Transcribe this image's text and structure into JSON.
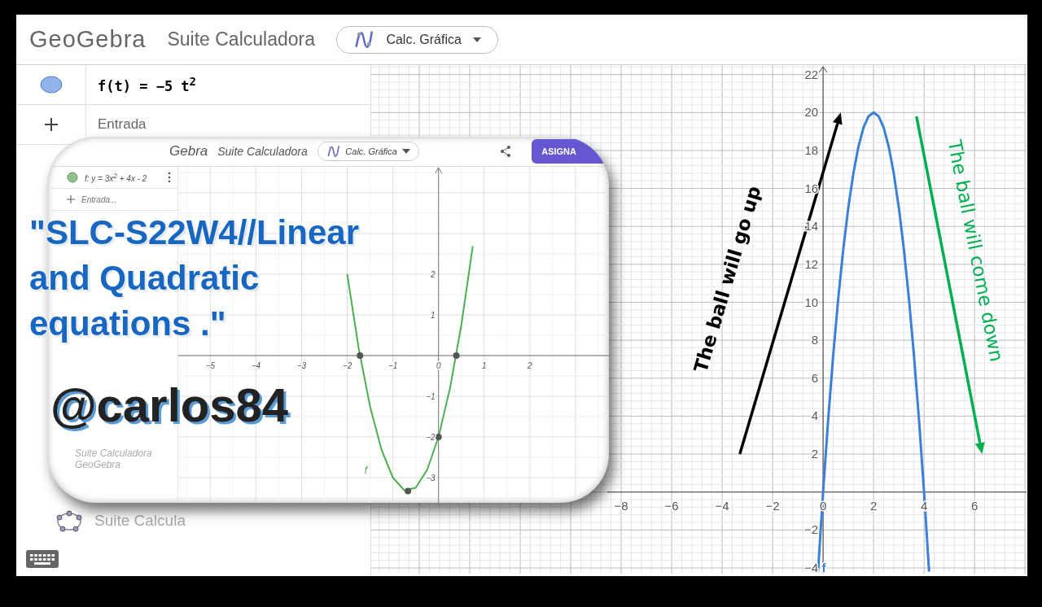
{
  "header": {
    "logo": "GeoGebra",
    "title": "Suite Calculadora",
    "app_menu": "Calc. Gráfica"
  },
  "algebra": {
    "expression": "f(t) = −5 t$^{2}$",
    "input_placeholder": "Entrada",
    "brand": "Suite Calcula"
  },
  "graph": {
    "chart_data": {
      "type": "line",
      "x": [
        -0.2,
        0,
        0.2,
        0.4,
        0.6,
        0.8,
        1,
        1.2,
        1.4,
        1.6,
        1.8,
        2,
        2.2,
        2.4,
        2.6,
        2.8,
        3,
        3.2,
        3.4,
        3.6,
        3.8,
        4,
        4.2
      ],
      "series": [
        {
          "name": "f",
          "color": "#3c7fd8",
          "values": [
            -4.2,
            0,
            3.8,
            7.2,
            10.2,
            12.8,
            15,
            16.8,
            18.2,
            19.2,
            19.8,
            20,
            19.8,
            19.2,
            18.2,
            16.8,
            15,
            12.8,
            10.2,
            7.2,
            3.8,
            0,
            -4.2
          ]
        }
      ],
      "xlim": [
        -8.55,
        8.06
      ],
      "ylim": [
        -4.3,
        22.5
      ],
      "grid": true,
      "xticks": [
        -8,
        -6,
        -4,
        -2,
        0,
        2,
        4,
        6
      ],
      "yticks": [
        -4,
        -2,
        2,
        4,
        6,
        8,
        10,
        12,
        14,
        16,
        18,
        20,
        22
      ],
      "annotations": [
        "The ball will go up",
        "The ball will come down"
      ]
    }
  },
  "inset": {
    "logo": "Gebra",
    "title": "Suite Calculadora",
    "app_menu": "Calc. Gráfica",
    "button": "ASIGNA",
    "expression": "f: y = 3x$^{2}$ + 4x - 2",
    "input_placeholder": "Entrada...",
    "caption": "Suite Calculadora GeoGebra",
    "chart_data": {
      "type": "line",
      "x": [
        -2,
        -1.75,
        -1.5,
        -1.25,
        -1,
        -0.75,
        -0.5,
        -0.25,
        0,
        0.25,
        0.5,
        0.75
      ],
      "series": [
        {
          "name": "f",
          "color": "#4caf50",
          "values": [
            2,
            0.19,
            -1.25,
            -2.31,
            -3,
            -3.31,
            -3.25,
            -2.81,
            -2,
            -0.81,
            0.75,
            2.69
          ]
        },
        {
          "type": "scatter",
          "color": "#555555",
          "x": [
            -1.72,
            0.39,
            0,
            -0.67
          ],
          "values": [
            0,
            0,
            -2,
            -3.33
          ]
        }
      ],
      "xlim": [
        -5.7,
        3.75
      ],
      "ylim": [
        -3.64,
        4.64
      ],
      "grid": true,
      "xticks": [
        -5,
        -4,
        -3,
        -2,
        -1,
        0,
        1,
        2
      ],
      "yticks": [
        -3,
        -2,
        -1,
        1,
        2
      ]
    }
  },
  "overlay": {
    "title": "\"SLC-S22W4//Linear and Quadratic equations .\"",
    "handle": "@carlos84"
  }
}
